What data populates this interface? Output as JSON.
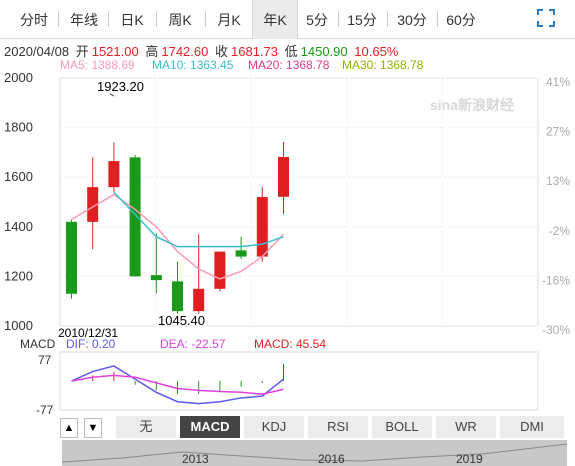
{
  "tabs": [
    {
      "label": "分时"
    },
    {
      "label": "年线"
    },
    {
      "label": "日K"
    },
    {
      "label": "周K"
    },
    {
      "label": "月K"
    },
    {
      "label": "年K"
    },
    {
      "label": "5分"
    },
    {
      "label": "15分"
    },
    {
      "label": "30分"
    },
    {
      "label": "60分"
    }
  ],
  "active_tab": "年K",
  "info": {
    "date": "2020/04/08",
    "open_label": "开",
    "open": "1521.00",
    "high_label": "高",
    "high": "1742.60",
    "close_label": "收",
    "close": "1681.73",
    "low_label": "低",
    "low": "1450.90",
    "change": "10.65%"
  },
  "ma": {
    "ma5": "MA5: 1388.69",
    "ma10": "MA10: 1363.45",
    "ma20": "MA20: 1368.78",
    "ma30": "MA30: 1368.78"
  },
  "colors": {
    "up": "#e02020",
    "down": "#1a9a1a",
    "ma5": "#ff9bb5",
    "ma10": "#3cbcd0",
    "dif": "#5a5af0",
    "dea": "#e040e0"
  },
  "price_axis": [
    "2000",
    "1800",
    "1600",
    "1400",
    "1200",
    "1000"
  ],
  "pct_axis": [
    "41%",
    "27%",
    "13%",
    "-2%",
    "-16%",
    "-30%"
  ],
  "labels": {
    "max": "1923.20",
    "min": "1045.40",
    "start_date": "2010/12/31"
  },
  "watermark": "sina新浪财经",
  "candles": [
    {
      "o": 1420,
      "h": 1430,
      "l": 1110,
      "c": 1130
    },
    {
      "o": 1420,
      "h": 1680,
      "l": 1310,
      "c": 1560
    },
    {
      "o": 1560,
      "h": 1740,
      "l": 1540,
      "c": 1665
    },
    {
      "o": 1680,
      "h": 1690,
      "l": 1200,
      "c": 1200
    },
    {
      "o": 1205,
      "h": 1375,
      "l": 1130,
      "c": 1185
    },
    {
      "o": 1180,
      "h": 1260,
      "l": 1050,
      "c": 1060
    },
    {
      "o": 1060,
      "h": 1370,
      "l": 1050,
      "c": 1150
    },
    {
      "o": 1150,
      "h": 1300,
      "l": 1140,
      "c": 1300
    },
    {
      "o": 1305,
      "h": 1360,
      "l": 1270,
      "c": 1280
    },
    {
      "o": 1280,
      "h": 1560,
      "l": 1260,
      "c": 1520
    },
    {
      "o": 1521,
      "h": 1742.6,
      "l": 1450.9,
      "c": 1681.73
    }
  ],
  "ma5_line": [
    1430,
    1480,
    1530,
    1470,
    1400,
    1300,
    1230,
    1190,
    1220,
    1280,
    1370
  ],
  "ma10_line": [
    null,
    null,
    1540,
    1450,
    1360,
    1320,
    1320,
    1320,
    1320,
    1330,
    1360
  ],
  "macd": {
    "label": "MACD",
    "dif": "DIF: 0.20",
    "dea": "DEA: -22.57",
    "macd": "MACD: 45.54",
    "top": "77",
    "bottom": "-77",
    "dif_line": [
      0,
      25,
      40,
      5,
      -30,
      -55,
      -60,
      -55,
      -45,
      -40,
      5
    ],
    "dea_line": [
      0,
      10,
      15,
      10,
      -5,
      -20,
      -25,
      -28,
      -30,
      -35,
      -22
    ],
    "bars": [
      0,
      15,
      25,
      -10,
      -25,
      -35,
      -35,
      -27,
      -15,
      -5,
      45
    ]
  },
  "indicator_tabs": [
    "无",
    "MACD",
    "KDJ",
    "RSI",
    "BOLL",
    "WR",
    "DMI"
  ],
  "active_indicator": "MACD",
  "nav_arrows": {
    "left": "▲",
    "right": "▼"
  },
  "years": [
    "2013",
    "2016",
    "2019"
  ]
}
